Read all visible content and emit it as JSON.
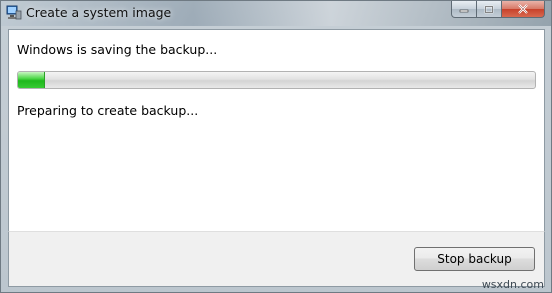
{
  "window": {
    "title": "Create a system image",
    "icon": "backup-computer-icon"
  },
  "main": {
    "heading": "Windows is saving the backup...",
    "progress": {
      "fraction": 0.05,
      "color": "#1fb81c"
    },
    "status": "Preparing to create backup..."
  },
  "footer": {
    "stop_label": "Stop backup"
  },
  "watermark": "wsxdn.com"
}
